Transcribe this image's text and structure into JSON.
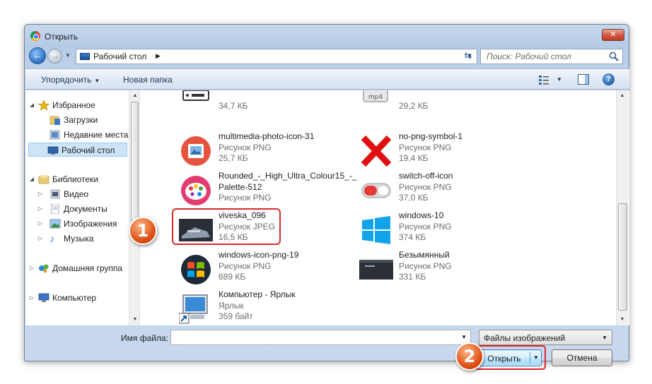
{
  "dialog": {
    "title": "Открыть",
    "close_label": "✕"
  },
  "navbar": {
    "address": "Рабочий стол",
    "search_placeholder": "Поиск: Рабочий стол"
  },
  "toolbar": {
    "organize_label": "Упорядочить",
    "new_folder_label": "Новая папка"
  },
  "sidebar": {
    "items": [
      {
        "label": "Избранное"
      },
      {
        "label": "Загрузки"
      },
      {
        "label": "Недавние места"
      },
      {
        "label": "Рабочий стол"
      },
      {
        "label": "Библиотеки"
      },
      {
        "label": "Видео"
      },
      {
        "label": "Документы"
      },
      {
        "label": "Изображения"
      },
      {
        "label": "Музыка"
      },
      {
        "label": "Домашняя группа"
      },
      {
        "label": "Компьютер"
      }
    ]
  },
  "files": [
    {
      "name": "",
      "type": "",
      "size": "34,7 КБ",
      "icon": "video-file-icon"
    },
    {
      "name": "",
      "type": "",
      "size": "29,2 КБ",
      "icon": "mp4-file-icon"
    },
    {
      "name": "multimedia-photo-icon-31",
      "type": "Рисунок PNG",
      "size": "25,7 КБ",
      "icon": "photo-icon"
    },
    {
      "name": "no-png-symbol-1",
      "type": "Рисунок PNG",
      "size": "19,4 КБ",
      "icon": "red-x-icon"
    },
    {
      "name": "Rounded_-_High_Ultra_Colour15_-_",
      "name2": "Palette-512",
      "type": "Рисунок PNG",
      "icon": "palette-icon"
    },
    {
      "name": "switch-off-icon",
      "type": "Рисунок PNG",
      "size": "37,0 КБ",
      "icon": "switch-icon"
    },
    {
      "name": "viveska_096",
      "type": "Рисунок JPEG",
      "size": "16,5 КБ",
      "icon": "jpeg-thumbnail"
    },
    {
      "name": "windows-10",
      "type": "Рисунок PNG",
      "size": "374 КБ",
      "icon": "windows10-logo"
    },
    {
      "name": "windows-icon-png-19",
      "type": "Рисунок PNG",
      "size": "689 КБ",
      "icon": "windows7-logo"
    },
    {
      "name": "Безымянный",
      "type": "Рисунок PNG",
      "size": "331 КБ",
      "icon": "screenshot-thumbnail"
    },
    {
      "name": "Компьютер - Ярлык",
      "type": "Ярлык",
      "size": "359 байт",
      "icon": "computer-shortcut-icon"
    }
  ],
  "footer": {
    "filename_label": "Имя файла:",
    "filename_value": "",
    "filetype_value": "Файлы изображений",
    "open_label": "Открыть",
    "cancel_label": "Отмена"
  },
  "annotations": {
    "marker1": "1",
    "marker2": "2",
    "color": "#d9282a"
  }
}
